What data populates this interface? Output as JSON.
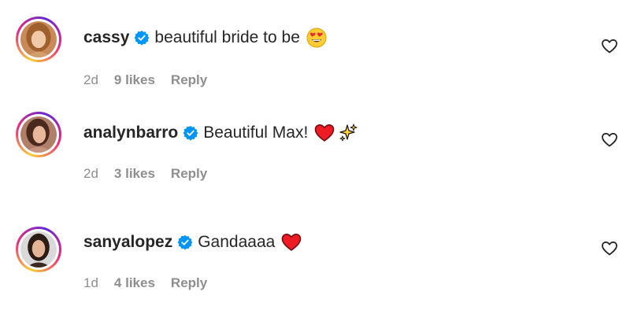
{
  "comments": [
    {
      "username": "cassy",
      "text": "beautiful bride to be",
      "emojis": [
        "heart-eyes-emoji"
      ],
      "time": "2d",
      "likes": "9 likes",
      "reply": "Reply"
    },
    {
      "username": "analynbarro",
      "text": "Beautiful Max!",
      "emojis": [
        "red-heart-emoji",
        "sparkles-emoji"
      ],
      "time": "2d",
      "likes": "3 likes",
      "reply": "Reply"
    },
    {
      "username": "sanyalopez",
      "text": "Gandaaaa",
      "emojis": [
        "red-heart-emoji"
      ],
      "time": "1d",
      "likes": "4 likes",
      "reply": "Reply"
    }
  ],
  "colors": {
    "verified": "#0095f6",
    "heart": "#ed1c24",
    "meta": "#8e8e8e",
    "text": "#262626"
  },
  "icons": {
    "verified": "verified-badge-icon",
    "like": "heart-outline-icon"
  }
}
